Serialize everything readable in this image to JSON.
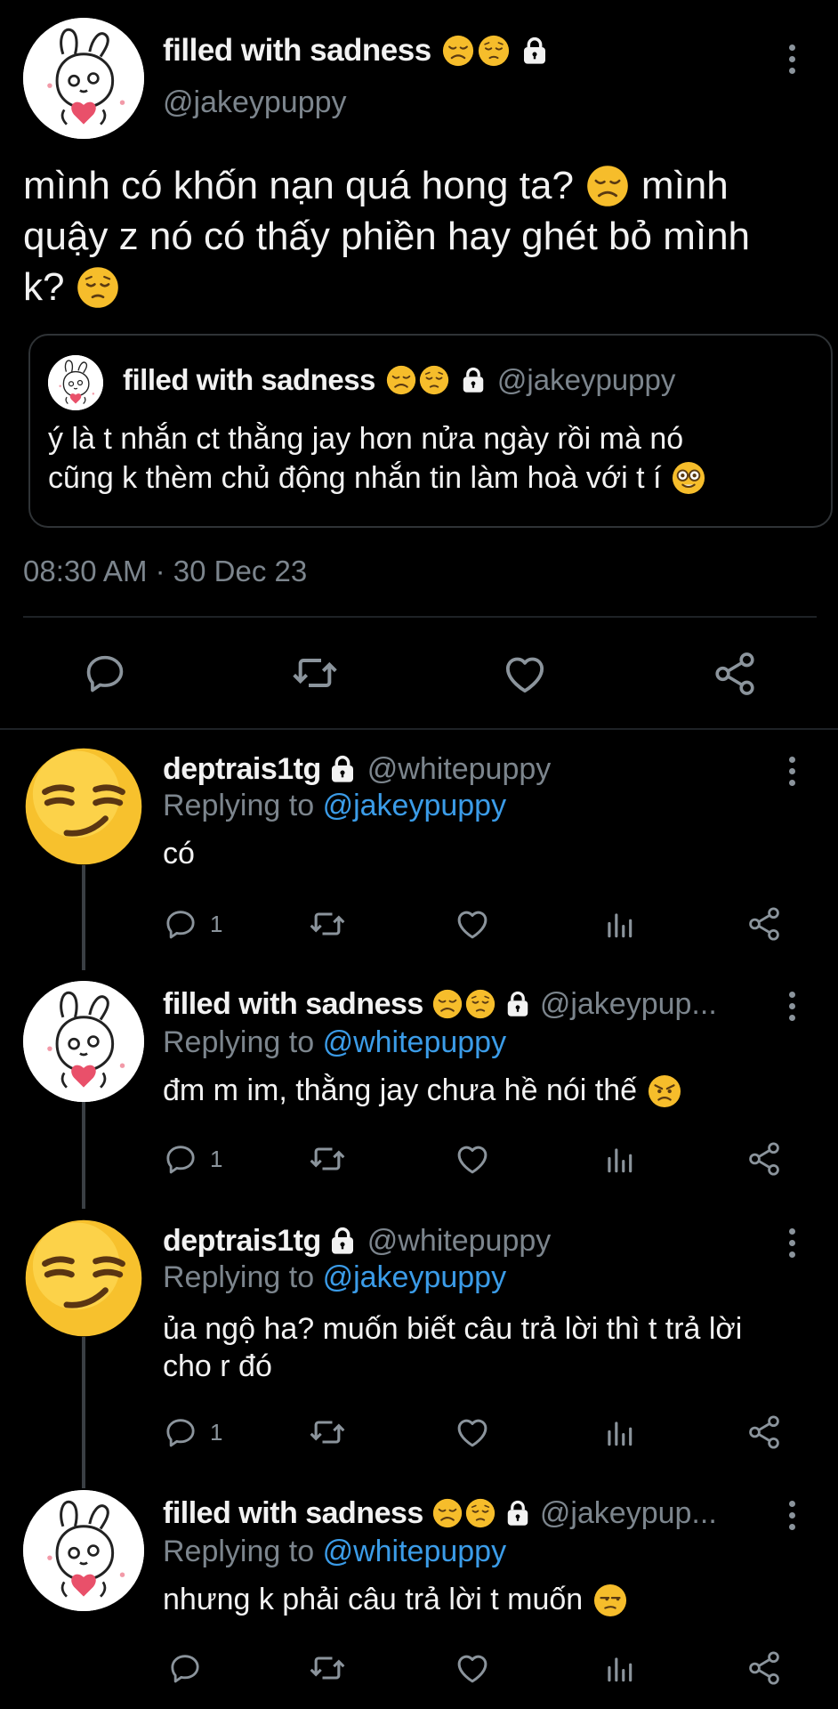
{
  "main_tweet": {
    "author_name": "filled with sadness",
    "author_handle": "@jakeypuppy",
    "text_line1": "mình có khốn nạn quá hong ta?",
    "text_line1b": "mình",
    "text_line2": "quậy z nó có thấy phiền hay ghét bỏ mình",
    "text_line3": "k?",
    "quoted": {
      "author_name": "filled with sadness",
      "author_handle": "@jakeypuppy",
      "text_line1": "ý là t nhắn ct thằng jay hơn nửa ngày rồi mà nó",
      "text_line2": "cũng k thèm chủ động nhắn tin làm hoà với t í"
    },
    "timestamp": "08:30 AM · 30 Dec 23"
  },
  "replies": [
    {
      "author_name": "deptrais1tg",
      "author_handle": "@whitepuppy",
      "replying_prefix": "Replying to",
      "replying_to": "@jakeypuppy",
      "text_line1": "có",
      "reply_count": "1"
    },
    {
      "author_name": "filled with sadness",
      "author_handle": "@jakeypup...",
      "replying_prefix": "Replying to",
      "replying_to": "@whitepuppy",
      "text_line1": "đm m im, thằng jay chưa hề nói thế",
      "reply_count": "1"
    },
    {
      "author_name": "deptrais1tg",
      "author_handle": "@whitepuppy",
      "replying_prefix": "Replying to",
      "replying_to": "@jakeypuppy",
      "text_line1": "ủa ngộ ha? muốn biết câu trả lời thì t trả lời",
      "text_line2": "cho r đó",
      "reply_count": "1"
    },
    {
      "author_name": "filled with sadness",
      "author_handle": "@jakeypup...",
      "replying_prefix": "Replying to",
      "replying_to": "@whitepuppy",
      "text_line1": "nhưng k phải câu trả lời t muốn",
      "reply_count": ""
    }
  ],
  "colors": {
    "background": "#000000",
    "text": "#e7e9ea",
    "muted": "#7c858d",
    "link": "#3b9ce8"
  },
  "icons": [
    "reply-icon",
    "retweet-icon",
    "like-icon",
    "share-icon",
    "analytics-icon",
    "more-icon",
    "lock-icon"
  ]
}
